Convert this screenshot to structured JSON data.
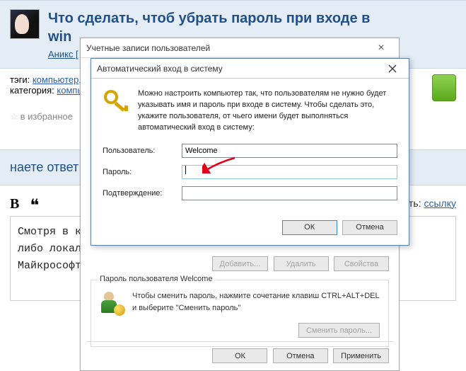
{
  "page": {
    "title": "Что сделать, чтоб убрать пароль при входе в windows",
    "title_line1": "Что сделать, чтоб убрать пароль при входе в",
    "title_line2": "win",
    "user_link": "Аникс [",
    "tags_prefix": "тэги: ",
    "tag1": "компьютер",
    "category_prefix": "категория: ",
    "cat1": "компь",
    "fav_star": "☆",
    "fav_text": "в избранное",
    "answer_header": "наете ответ",
    "add_prefix": "добавить: ",
    "add_link": "ссылку",
    "editor_body": "Смотря в какой версии Виндовс. Вы его вводили при установке? Учетная запись либо локальная?\nМайкрософт"
  },
  "outer_dialog": {
    "title": "Учетные записи пользователей",
    "btn_add": "Добавить...",
    "btn_del": "Удалить",
    "btn_props": "Свойства",
    "group_title": "Пароль пользователя Welcome",
    "group_text": "Чтобы сменить пароль, нажмите сочетание клавиш CTRL+ALT+DEL и выберите \"Сменить пароль\"",
    "btn_change_pwd": "Сменить пароль...",
    "btn_ok": "ОК",
    "btn_cancel": "Отмена",
    "btn_apply": "Применить"
  },
  "inner_dialog": {
    "title": "Автоматический вход в систему",
    "info": "Можно настроить компьютер так, что пользователям не нужно будет указывать имя и пароль при входе в систему. Чтобы сделать это, укажите пользователя, от чьего имени будет выполняться автоматический вход в систему:",
    "label_user": "Пользователь:",
    "value_user": "Welcome",
    "label_pass": "Пароль:",
    "label_confirm": "Подтверждение:",
    "btn_ok": "ОК",
    "btn_cancel": "Отмена"
  }
}
